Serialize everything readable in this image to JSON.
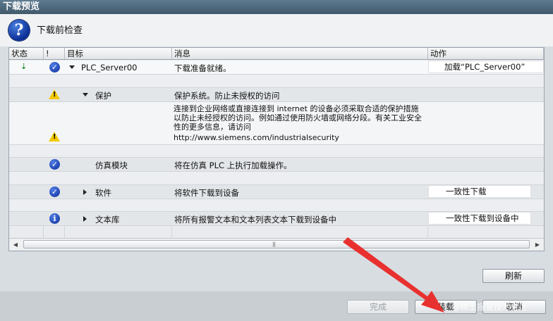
{
  "window": {
    "title": "下载预览"
  },
  "header": {
    "title": "下载前检查"
  },
  "columns": {
    "status": "状态",
    "flag": "!",
    "target": "目标",
    "message": "消息",
    "action": "动作"
  },
  "rows": [
    {
      "target": "PLC_Server00",
      "message": "下载准备就绪。",
      "action": "加载“PLC_Server00”"
    },
    {
      "target": "保护",
      "message": "保护系统。防止未授权的访问"
    },
    {
      "message": "连接到企业网络或直接连接到 internet 的设备必须采取合适的保护措施以防止未经授权的访问。例如通过使用防火墙或网络分段。有关工业安全性的更多信息，请访问",
      "link": "http://www.siemens.com/industrialsecurity"
    },
    {
      "target": "仿真模块",
      "message": "将在仿真 PLC 上执行加载操作。"
    },
    {
      "target": "软件",
      "message": "将软件下载到设备",
      "action": "一致性下载"
    },
    {
      "target": "文本库",
      "message": "将所有报警文本和文本列表文本下载到设备中",
      "action": "一致性下载到设备中"
    }
  ],
  "buttons": {
    "refresh": "刷新",
    "finish": "完成",
    "load": "装载",
    "cancel": "取消"
  },
  "watermark": "@稀土掘金技术社区",
  "colors": {
    "titlebar": "#41596b",
    "warning": "#f3c900",
    "check": "#0c2e9a",
    "arrow": "#e8312f"
  }
}
